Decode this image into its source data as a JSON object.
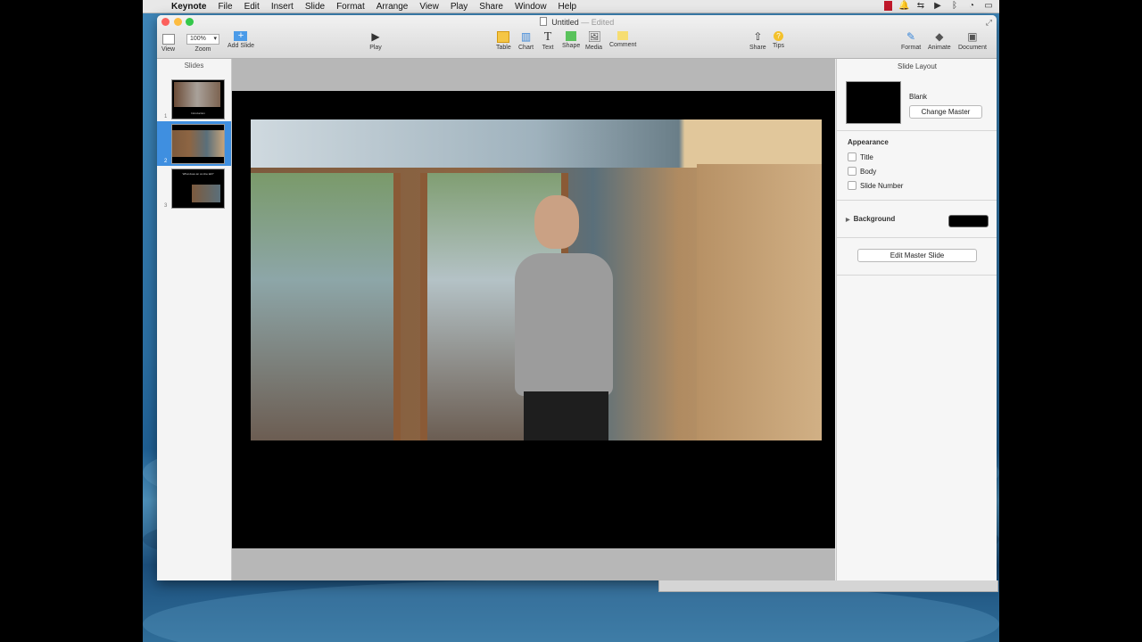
{
  "menubar": {
    "app": "Keynote",
    "items": [
      "File",
      "Edit",
      "Insert",
      "Slide",
      "Format",
      "Arrange",
      "View",
      "Play",
      "Share",
      "Window",
      "Help"
    ]
  },
  "window": {
    "title": "Untitled",
    "title_status": "— Edited",
    "toolbar": {
      "view": "View",
      "zoom_value": "100%",
      "zoom": "Zoom",
      "add_slide": "Add Slide",
      "play": "Play",
      "table": "Table",
      "chart": "Chart",
      "text": "Text",
      "shape": "Shape",
      "media": "Media",
      "comment": "Comment",
      "share": "Share",
      "tips": "Tips",
      "format": "Format",
      "animate": "Animate",
      "document": "Document"
    }
  },
  "slides_panel": {
    "header": "Slides",
    "thumbnails": [
      {
        "number": "1",
        "caption": "Introduction"
      },
      {
        "number": "2"
      },
      {
        "number": "3",
        "caption": "What does an on-line lab?"
      }
    ]
  },
  "inspector": {
    "title": "Slide Layout",
    "master_name": "Blank",
    "change_master": "Change Master",
    "appearance_label": "Appearance",
    "options": [
      "Title",
      "Body",
      "Slide Number"
    ],
    "background_label": "Background",
    "background_color": "#000000",
    "edit_master": "Edit Master Slide"
  },
  "colors": {
    "accent": "#3f8fe0",
    "close": "#fc605c",
    "minimize": "#fdbc40",
    "zoom": "#34c84a"
  }
}
